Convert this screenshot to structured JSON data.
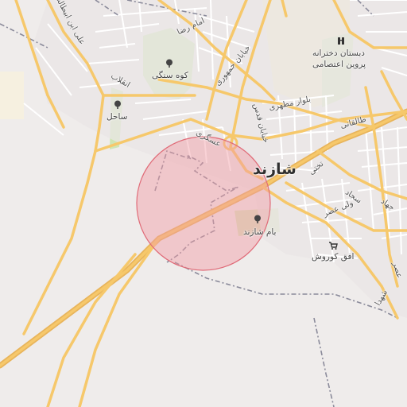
{
  "map": {
    "place_labels": {
      "city": "شازند",
      "koh_sangi": "کوه سنگی",
      "sahel": "ساحل",
      "bam_shazand": "بام شازند",
      "ofogh_kourosh": "افق کوروش",
      "school_line1": "دبستان دخترانه",
      "school_line2": "پروین اعتصامی"
    },
    "road_labels": {
      "jomhouri": "خیابان جمهوری",
      "enghelab": "انقلاب",
      "motahari": "بلوار مطهری",
      "ghods": "خیابان قدس",
      "asgari": "عسگری",
      "taleghani": "طالقانی",
      "vali_asr": "ولی عصر",
      "sajjad": "سجاد",
      "jahad": "جهاد",
      "emam_reza": "امام رضا",
      "ali_ebne_abitaleb": "علی ابن ابیطالب",
      "takhti": "تختی",
      "asr": "عصر",
      "shohada": "شهدا"
    },
    "icons": {
      "tree_koh_sangi": "tree-icon",
      "tree_sahel": "tree-icon",
      "tree_bam": "tree-icon",
      "school": "school-icon",
      "shop": "shopping-cart-icon"
    },
    "colors": {
      "background": "#efeceb",
      "road_major": "#f6c86b",
      "road_minor": "#ffffff",
      "park": "#cfe5b4",
      "boundary": "#8a8a9a",
      "highlight_fill": "#f29ca4",
      "highlight_stroke": "#e06b78"
    }
  }
}
